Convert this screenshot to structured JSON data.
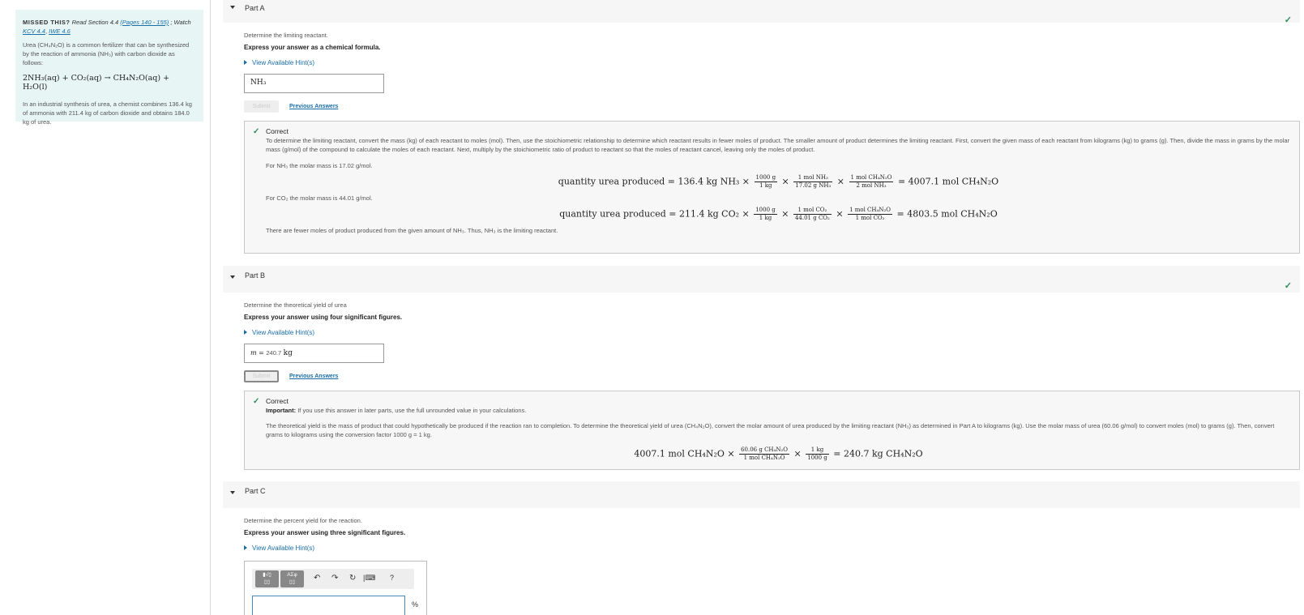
{
  "sidebar": {
    "missed_label": "MISSED THIS?",
    "read_text": "Read Section 4.4",
    "pages_link": "(Pages 140 - 155)",
    "watch_text": "; Watch",
    "kcv_link": "KCV 4.4",
    "iwe_link": "IWE 4.6",
    "intro": "Urea (CH₄N₂O) is a common fertilizer that can be synthesized by the reaction of ammonia (NH₃) with carbon dioxide as follows:",
    "equation": "2NH₃(aq) + CO₂(aq) → CH₄N₂O(aq) + H₂O(l)",
    "problem": "In an industrial synthesis of urea, a chemist combines 136.4 kg of ammonia with 211.4 kg of carbon dioxide and obtains 184.0 kg of urea."
  },
  "common": {
    "hint_label": "View Available Hint(s)",
    "submit_label": "Submit",
    "previous_label": "Previous Answers",
    "correct_label": "Correct"
  },
  "partA": {
    "title": "Part A",
    "question": "Determine the limiting reactant.",
    "instruction": "Express your answer as a chemical formula.",
    "answer": "NH₃",
    "explanation": "To determine the limiting reactant, convert the mass (kg) of each reactant to moles (mol). Then, use the stoichiometric relationship to determine which reactant results in fewer moles of product. The smaller amount of product determines the limiting reactant. First, convert the given mass of each reactant from kilograms (kg) to grams (g). Then, divide the mass in grams by the molar mass (g/mol) of the compound to calculate the moles of each reactant. Next, multiply by the stoichiometric ratio of product to reactant so that the moles of reactant cancel, leaving only the moles of product.",
    "nh3_molar": "For NH₃ the molar mass is 17.02 g/mol.",
    "eq1_left": "quantity urea produced = 136.4 kg NH₃ ×",
    "eq1_f1_num": "1000 g",
    "eq1_f1_den": "1 kg",
    "eq1_f2_num": "1 mol NH₃",
    "eq1_f2_den": "17.02 g NH₃",
    "eq1_f3_num": "1 mol CH₄N₂O",
    "eq1_f3_den": "2 mol NH₃",
    "eq1_result": "= 4007.1 mol CH₄N₂O",
    "co2_molar": "For CO₂ the molar mass is 44.01 g/mol.",
    "eq2_left": "quantity urea produced = 211.4 kg CO₂ ×",
    "eq2_f1_num": "1000 g",
    "eq2_f1_den": "1 kg",
    "eq2_f2_num": "1 mol CO₂",
    "eq2_f2_den": "44.01 g CO₂",
    "eq2_f3_num": "1 mol CH₄N₂O",
    "eq2_f3_den": "1 mol CO₂",
    "eq2_result": "= 4803.5 mol CH₄N₂O",
    "conclusion": "There are fewer moles of product produced from the given amount of NH₃. Thus, NH₃ is the limiting reactant."
  },
  "partB": {
    "title": "Part B",
    "question": "Determine the theoretical yield of urea",
    "instruction": "Express your answer using four significant figures.",
    "answer_var": "m =",
    "answer_value": "240.7",
    "answer_unit": "kg",
    "important_label": "Important:",
    "important_text": "If you use this answer in later parts, use the full unrounded value in your calculations.",
    "explanation": "The theoretical yield is the mass of product that could hypothetically be produced if the reaction ran to completion. To determine the theoretical yield of urea (CH₄N₂O), convert the molar amount of urea produced by the limiting reactant (NH₃) as determined in Part A to kilograms (kg). Use the molar mass of urea (60.06 g/mol) to convert moles (mol) to grams (g). Then, convert grams to kilograms using the conversion factor 1000 g = 1 kg.",
    "eq_left": "4007.1 mol CH₄N₂O ×",
    "f1_num": "60.06 g CH₄N₂O",
    "f1_den": "1 mol CH₄N₂O",
    "f2_num": "1 kg",
    "f2_den": "1000 g",
    "eq_result": "= 240.7 kg CH₄N₂O"
  },
  "partC": {
    "title": "Part C",
    "question": "Determine the percent yield for the reaction.",
    "instruction": "Express your answer using three significant figures.",
    "unit": "%",
    "tb_templates": "ΑΣφ",
    "tb_help": "?"
  }
}
